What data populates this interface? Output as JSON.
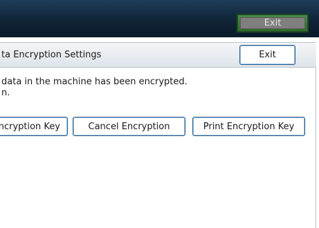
{
  "header": {
    "exit_label": "Exit"
  },
  "titlebar": {
    "title": "ta Encryption Settings",
    "exit_label": "Exit"
  },
  "message": {
    "line1": " data in the machine has been encrypted.",
    "line2": "n."
  },
  "actions": {
    "change_key_label": "ncryption Key",
    "cancel_label": "Cancel Encryption",
    "print_key_label": "Print Encryption Key"
  },
  "colors": {
    "header_bg": "#0f2436",
    "header_exit_border": "#2f6a2f",
    "button_border": "#2b5f8f"
  }
}
